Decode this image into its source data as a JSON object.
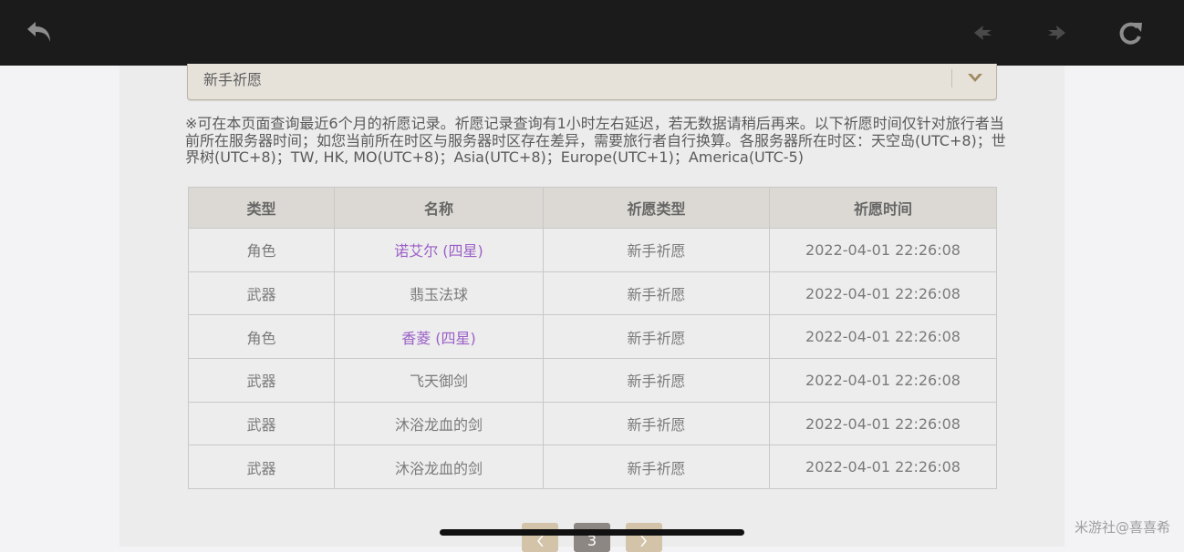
{
  "select": {
    "value": "新手祈愿"
  },
  "notice": "※可在本页面查询最近6个月的祈愿记录。祈愿记录查询有1小时左右延迟，若无数据请稍后再来。以下祈愿时间仅针对旅行者当前所在服务器时间；如您当前所在时区与服务器时区存在差异，需要旅行者自行换算。各服务器所在时区：天空岛(UTC+8)；世界树(UTC+8)；TW, HK, MO(UTC+8)；Asia(UTC+8)；Europe(UTC+1)；America(UTC-5)",
  "table": {
    "headers": [
      "类型",
      "名称",
      "祈愿类型",
      "祈愿时间"
    ],
    "rows": [
      {
        "type": "角色",
        "name": "诺艾尔 (四星)",
        "wish_type": "新手祈愿",
        "time": "2022-04-01 22:26:08",
        "highlight": true
      },
      {
        "type": "武器",
        "name": "翡玉法球",
        "wish_type": "新手祈愿",
        "time": "2022-04-01 22:26:08",
        "highlight": false
      },
      {
        "type": "角色",
        "name": "香菱 (四星)",
        "wish_type": "新手祈愿",
        "time": "2022-04-01 22:26:08",
        "highlight": true
      },
      {
        "type": "武器",
        "name": "飞天御剑",
        "wish_type": "新手祈愿",
        "time": "2022-04-01 22:26:08",
        "highlight": false
      },
      {
        "type": "武器",
        "name": "沐浴龙血的剑",
        "wish_type": "新手祈愿",
        "time": "2022-04-01 22:26:08",
        "highlight": false
      },
      {
        "type": "武器",
        "name": "沐浴龙血的剑",
        "wish_type": "新手祈愿",
        "time": "2022-04-01 22:26:08",
        "highlight": false
      }
    ]
  },
  "pagination": {
    "current": "3"
  },
  "watermark": "米游社@喜喜希",
  "icons": {
    "back": "back-arrow-icon",
    "nav_prev": "nav-prev-icon",
    "nav_next": "nav-next-icon",
    "refresh": "refresh-icon"
  },
  "colors": {
    "topbar": "#1b1b1b",
    "highlight": "#9b5fc8",
    "pager": "#d3c3a9",
    "pager_current": "#8c8782"
  }
}
